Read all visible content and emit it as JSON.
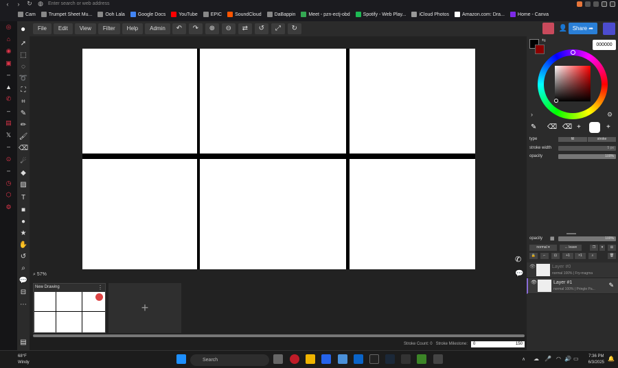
{
  "browser": {
    "url_placeholder": "Enter search or web address",
    "bookmarks": [
      {
        "label": "Cam",
        "color": "#888888"
      },
      {
        "label": "Trumpet Sheet Mu...",
        "color": "#888888"
      },
      {
        "label": "Ooh Lala",
        "color": "#888888"
      },
      {
        "label": "Google Docs",
        "color": "#4285f4"
      },
      {
        "label": "YouTube",
        "color": "#ff0000"
      },
      {
        "label": "EPIC",
        "color": "#888888"
      },
      {
        "label": "SoundCloud",
        "color": "#ff5500"
      },
      {
        "label": "DaBappin",
        "color": "#888888"
      },
      {
        "label": "Meet - pzn-ectj-obd",
        "color": "#34a853"
      },
      {
        "label": "Spotify - Web Play...",
        "color": "#1db954"
      },
      {
        "label": "iCloud Photos",
        "color": "#999999"
      },
      {
        "label": "Amazon.com: Dra...",
        "color": "#ffffff"
      },
      {
        "label": "Home - Canva",
        "color": "#7d2ae8"
      }
    ]
  },
  "menu": {
    "items": [
      "File",
      "Edit",
      "View",
      "Filter",
      "Help",
      "Admin"
    ],
    "share_label": "Share"
  },
  "canvas": {
    "zoom": "57%"
  },
  "drawings": {
    "current_title": "New Drawing",
    "add_symbol": "+"
  },
  "status": {
    "stroke_count": "Stroke Count: 0",
    "stroke_milestone_label": "Stroke Milestone:",
    "milestone_value": "0",
    "milestone_max": "150"
  },
  "color_panel": {
    "hex": "000000",
    "primary_color": "#000000",
    "secondary_color": "#8b0000"
  },
  "brush": {
    "type_label": "type",
    "fill_label": "fill",
    "stroke_label": "stroke",
    "stroke_width_label": "stroke width",
    "stroke_width_value": "5 px",
    "opacity_label": "opacity",
    "opacity_value": "100%"
  },
  "layers_panel": {
    "opacity_label": "opacity",
    "opacity_value": "100%",
    "blend_mode": "normal",
    "leave_label": "leave",
    "plus1": "+1",
    "times1": "×1",
    "layers": [
      {
        "name": "Layer #0",
        "sub": "normal 100% | Fry-magma",
        "active": false
      },
      {
        "name": "Layer #1",
        "sub": "normal 100% | Pringle Pa...",
        "active": true
      }
    ]
  },
  "taskbar": {
    "temp": "68°F",
    "weather": "Windy",
    "search_label": "Search",
    "time": "7:36 PM",
    "date": "6/3/2025"
  }
}
